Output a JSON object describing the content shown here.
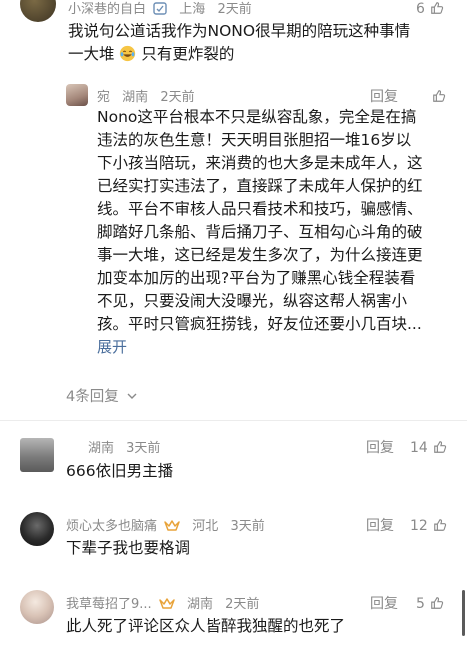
{
  "comments": [
    {
      "user": "小深巷的自白",
      "location": "上海",
      "time": "2天前",
      "likes": "6",
      "text_line1": "我说句公道话我作为NONO很早期的陪玩这种事情",
      "text_line2a": "一大堆",
      "text_line2b": "只有更炸裂的",
      "emoji": "laughing-tears-emoji"
    },
    {
      "user": "宛",
      "location": "湖南",
      "time": "2天前",
      "reply_label": "回复",
      "likes": "",
      "lines": [
        "Nono这平台根本不只是纵容乱象，完全是在搞",
        "违法的灰色生意！天天明目张胆招一堆16岁以",
        "下小孩当陪玩，来消费的也大多是未成年人，这",
        "已经实打实违法了，直接踩了未成年人保护的红",
        "线。平台不审核人品只看技术和技巧，骗感情、",
        "脚踏好几条船、背后捅刀子、互相勾心斗角的破",
        "事一大堆，这已经是发生多次了，为什么接连更",
        "加变本加厉的出现?平台为了赚黑心钱全程装看",
        "不见，只要没闹大没曝光，纵容这帮人祸害小",
        "孩。平时只管疯狂捞钱，好友位还要小几百块..."
      ],
      "expand_label": "展开"
    }
  ],
  "more_replies": "4条回复",
  "top_level": [
    {
      "user": "",
      "location": "湖南",
      "time": "3天前",
      "reply_label": "回复",
      "likes": "14",
      "text": "666依旧男主播"
    },
    {
      "user": "烦心太多也脑痛",
      "location": "河北",
      "time": "3天前",
      "reply_label": "回复",
      "likes": "12",
      "text": "下辈子我也要格调"
    },
    {
      "user": "我草莓招了9...",
      "location": "湖南",
      "time": "2天前",
      "reply_label": "回复",
      "likes": "5",
      "text": "此人死了评论区众人皆醉我独醒的也死了"
    }
  ],
  "colors": {
    "meta_gray": "#8a8a8a",
    "badge_orange": "#e8a33a",
    "link_blue": "#4a6e9c"
  }
}
